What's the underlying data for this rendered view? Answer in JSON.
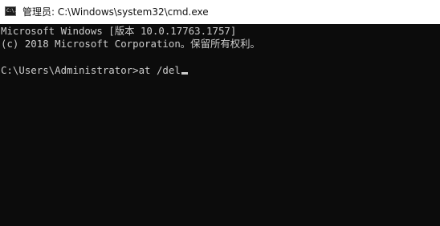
{
  "window": {
    "title": "管理员: C:\\Windows\\system32\\cmd.exe",
    "icon": "cmd-console-icon",
    "icon_glyph": "C:\\."
  },
  "console": {
    "background": "#0c0c0c",
    "foreground": "#cccccc",
    "banner_line_1": "Microsoft Windows [版本 10.0.17763.1757]",
    "banner_line_2": "(c) 2018 Microsoft Corporation。保留所有权利。",
    "prompt": "C:\\Users\\Administrator>",
    "command": "at /del"
  }
}
